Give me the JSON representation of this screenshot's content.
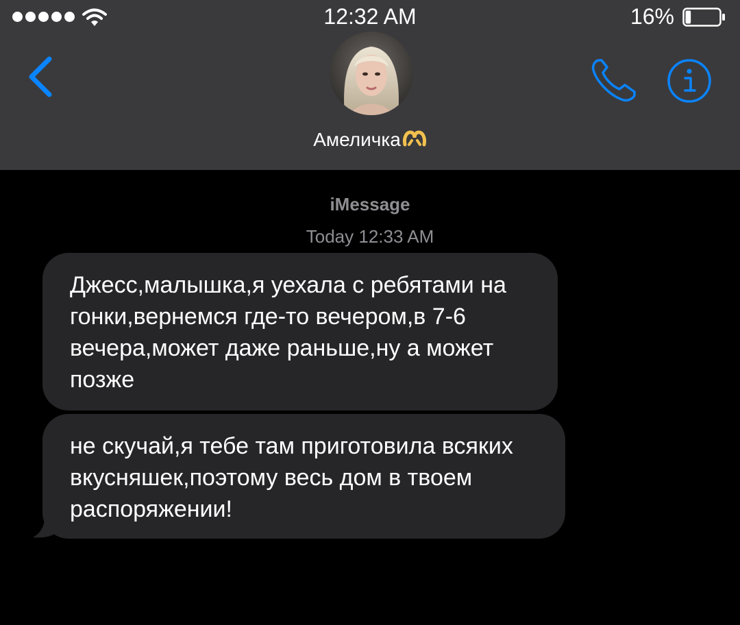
{
  "status_bar": {
    "time": "12:32 AM",
    "battery_percent": "16%",
    "battery_level": 0.16,
    "signal_bars": 5
  },
  "header": {
    "contact_name": "Амеличка",
    "contact_emoji": "🫶",
    "back_icon": "chevron-left-icon",
    "call_icon": "phone-icon",
    "info_icon": "info-icon"
  },
  "chat": {
    "service": "iMessage",
    "timestamp": "Today 12:33 AM",
    "messages": [
      {
        "direction": "incoming",
        "text": "Джесс,малышка,я уехала с ребятами на гонки,вернемся где-то вечером,в 7-6 вечера,может даже раньше,ну а может позже"
      },
      {
        "direction": "incoming",
        "text": "не скучай,я тебе там приготовила всяких вкусняшек,поэтому весь дом в твоем распоряжении!"
      }
    ]
  },
  "colors": {
    "accent": "#0a84ff",
    "header_bg": "#3a3a3c",
    "background": "#000000",
    "incoming_bubble": "#262628",
    "secondary_text": "#8e8e93"
  }
}
